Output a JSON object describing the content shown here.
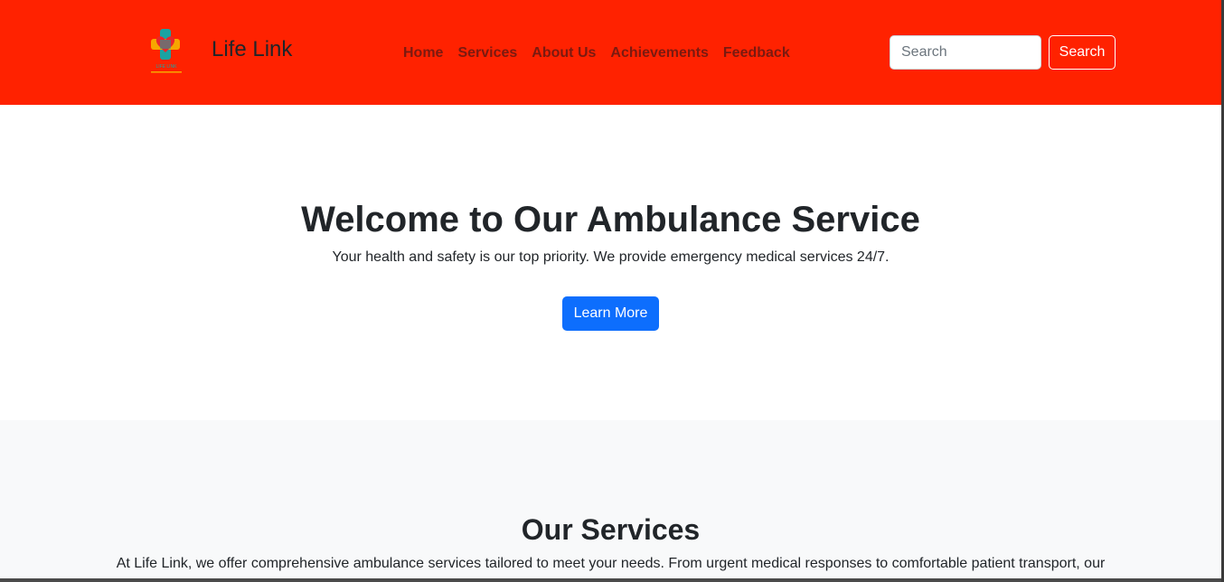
{
  "navbar": {
    "brand_name": "Life Link",
    "logo_text": "LIFE LINK",
    "links": [
      {
        "label": "Home"
      },
      {
        "label": "Services"
      },
      {
        "label": "About Us"
      },
      {
        "label": "Achievements"
      },
      {
        "label": "Feedback"
      }
    ],
    "search": {
      "placeholder": "Search",
      "value": "",
      "button_label": "Search"
    },
    "background_color": "#ff2200"
  },
  "hero": {
    "title": "Welcome to Our Ambulance Service",
    "subtitle": "Your health and safety is our top priority. We provide emergency medical services 24/7.",
    "button_label": "Learn More",
    "button_color": "#0d6efd"
  },
  "services": {
    "title": "Our Services",
    "intro": "At Life Link, we offer comprehensive ambulance services tailored to meet your needs. From urgent medical responses to comfortable patient transport, our"
  }
}
